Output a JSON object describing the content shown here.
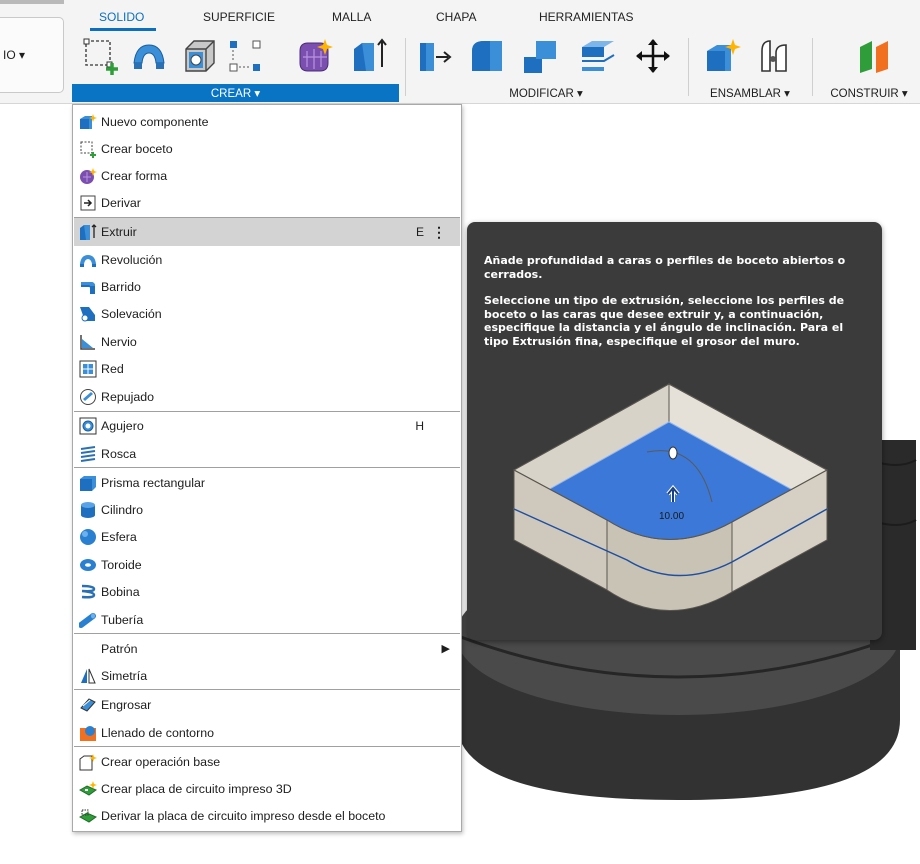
{
  "toolbar": {
    "left_dropdown_label": "IO ▾",
    "tabs": [
      "SOLIDO",
      "SUPERFICIE",
      "MALLA",
      "CHAPA",
      "HERRAMIENTAS"
    ],
    "active_tab": "SOLIDO",
    "groups": {
      "crear": "CREAR ▾",
      "modificar": "MODIFICAR ▾",
      "ensamblar": "ENSAMBLAR ▾",
      "construir": "CONSTRUIR ▾"
    },
    "accent_color": "#0a74c4"
  },
  "menu": {
    "items": [
      {
        "label": "Nuevo componente",
        "icon": "new-component-icon"
      },
      {
        "label": "Crear boceto",
        "icon": "sketch-icon"
      },
      {
        "label": "Crear forma",
        "icon": "form-icon"
      },
      {
        "label": "Derivar",
        "icon": "derive-icon"
      },
      {
        "label": "Extruir",
        "icon": "extrude-icon",
        "shortcut": "E",
        "highlighted": true
      },
      {
        "label": "Revolución",
        "icon": "revolve-icon"
      },
      {
        "label": "Barrido",
        "icon": "sweep-icon"
      },
      {
        "label": "Solevación",
        "icon": "loft-icon"
      },
      {
        "label": "Nervio",
        "icon": "rib-icon"
      },
      {
        "label": "Red",
        "icon": "web-icon"
      },
      {
        "label": "Repujado",
        "icon": "emboss-icon"
      },
      {
        "label": "Agujero",
        "icon": "hole-icon",
        "shortcut": "H"
      },
      {
        "label": "Rosca",
        "icon": "thread-icon"
      },
      {
        "label": "Prisma rectangular",
        "icon": "box-icon"
      },
      {
        "label": "Cilindro",
        "icon": "cylinder-icon"
      },
      {
        "label": "Esfera",
        "icon": "sphere-icon"
      },
      {
        "label": "Toroide",
        "icon": "torus-icon"
      },
      {
        "label": "Bobina",
        "icon": "coil-icon"
      },
      {
        "label": "Tubería",
        "icon": "pipe-icon"
      },
      {
        "label": "Patrón",
        "icon": "",
        "submenu": true
      },
      {
        "label": "Simetría",
        "icon": "mirror-icon"
      },
      {
        "label": "Engrosar",
        "icon": "thicken-icon"
      },
      {
        "label": "Llenado de contorno",
        "icon": "boundary-fill-icon"
      },
      {
        "label": "Crear operación base",
        "icon": "base-feature-icon"
      },
      {
        "label": "Crear placa de circuito impreso 3D",
        "icon": "pcb-3d-icon"
      },
      {
        "label": "Derivar la placa de circuito impreso desde el boceto",
        "icon": "pcb-derive-icon"
      }
    ]
  },
  "tooltip": {
    "paragraph1": "Añade profundidad a caras o perfiles de boceto abiertos o cerrados.",
    "paragraph2": "Seleccione un tipo de extrusión, seleccione los perfiles de boceto o las caras que desee extruir y, a continuación, especifique la distancia y el ángulo de inclinación. Para el tipo Extrusión fina, especifique el grosor del muro.",
    "dimension_value": "10.00"
  }
}
